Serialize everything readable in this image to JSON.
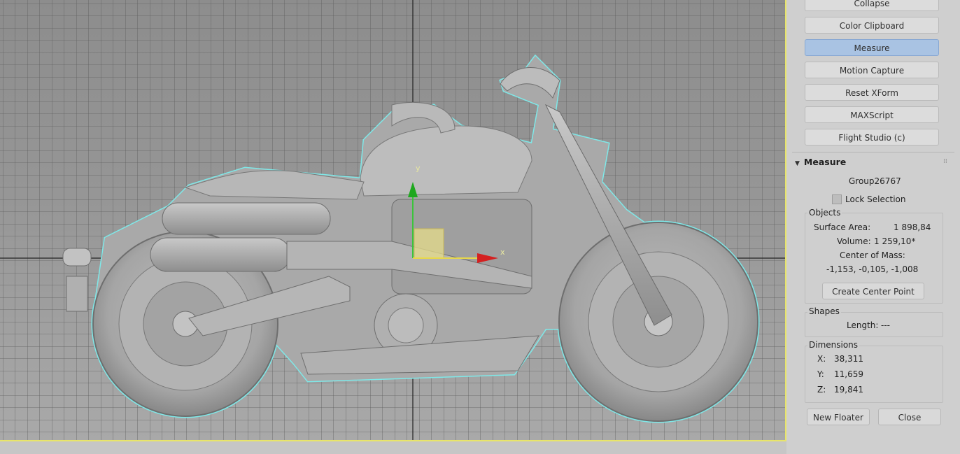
{
  "utilities": {
    "collapse": "Collapse",
    "color_clipboard": "Color Clipboard",
    "measure": "Measure",
    "motion_capture": "Motion Capture",
    "reset_xform": "Reset XForm",
    "maxscript": "MAXScript",
    "flight_studio": "Flight Studio (c)"
  },
  "measure_panel": {
    "title": "Measure",
    "object_name": "Group26767",
    "lock_selection": "Lock Selection",
    "objects_label": "Objects",
    "surface_area_label": "Surface Area:",
    "surface_area_value": "1 898,84",
    "volume_label": "Volume:",
    "volume_value": "1 259,10*",
    "center_of_mass_label": "Center of Mass:",
    "center_of_mass_value": "-1,153, -0,105, -1,008",
    "create_center_point": "Create Center Point",
    "shapes_label": "Shapes",
    "length_label": "Length:",
    "length_value": "---",
    "dimensions_label": "Dimensions",
    "x_label": "X:",
    "x_value": "38,311",
    "y_label": "Y:",
    "y_value": "11,659",
    "z_label": "Z:",
    "z_value": "19,841",
    "new_floater": "New Floater",
    "close": "Close"
  },
  "gizmo": {
    "x_axis": "x",
    "y_axis": "y"
  },
  "colors": {
    "active_button": "#a9c3e3",
    "selection_outline": "#7fe8e8",
    "viewport_border": "#e8e56a"
  }
}
